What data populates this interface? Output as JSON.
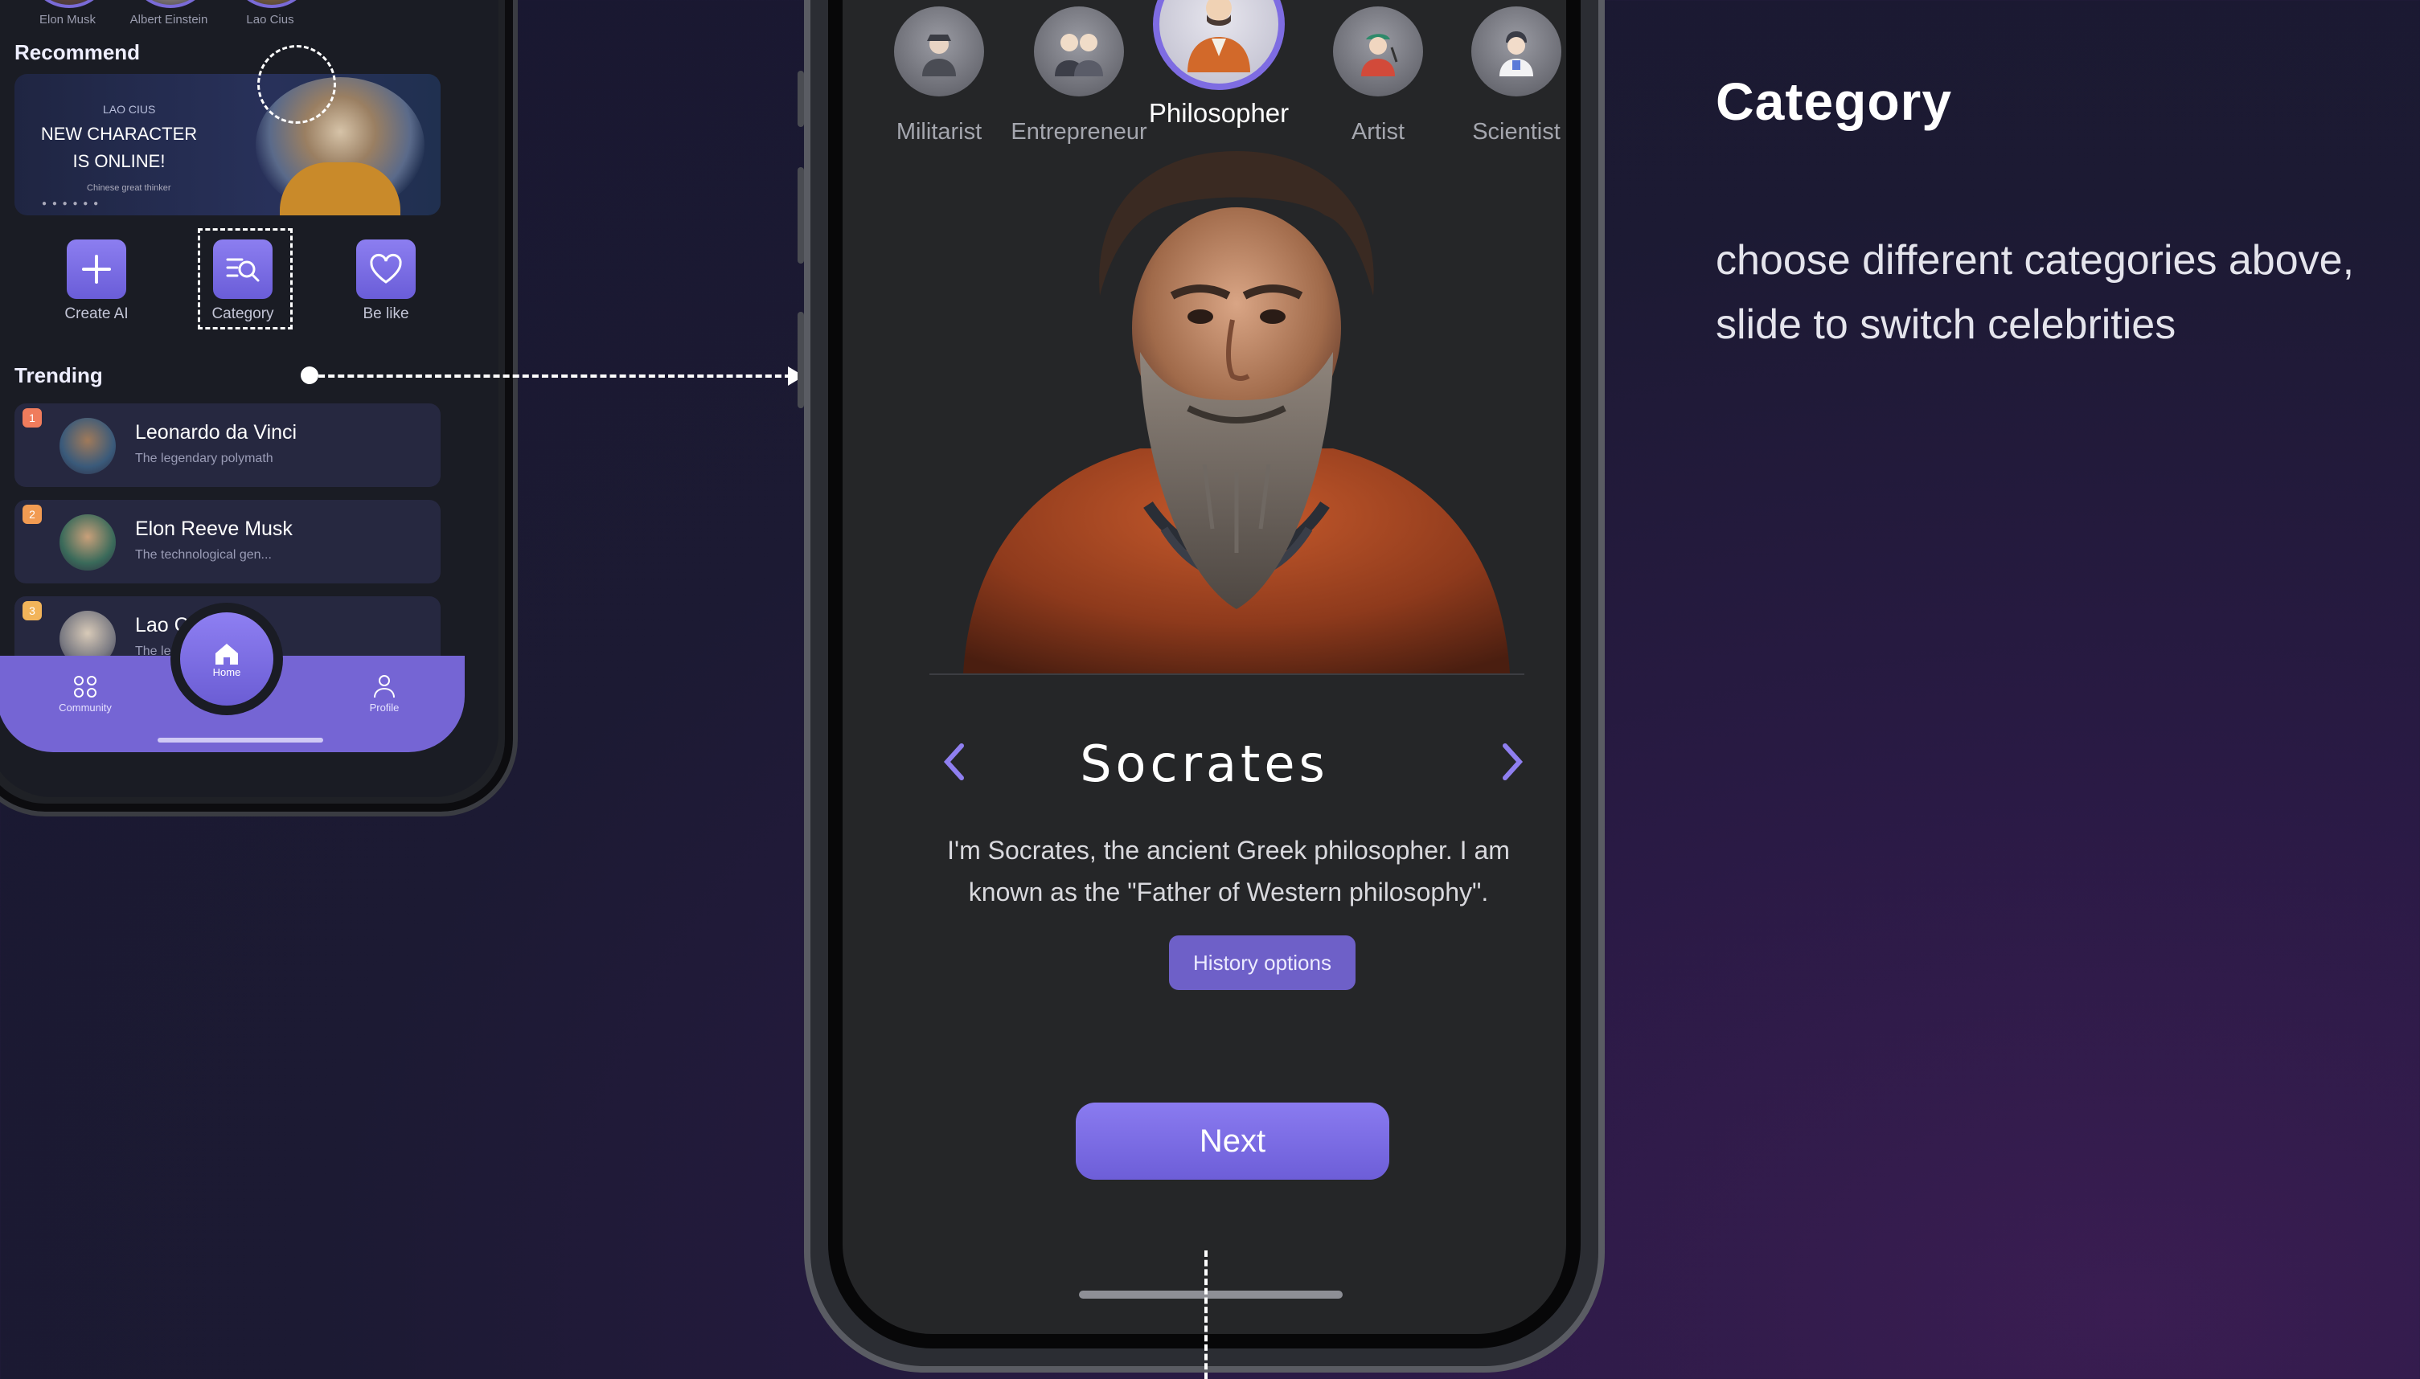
{
  "left_phone": {
    "avatars": [
      {
        "label": "Elon Musk"
      },
      {
        "label": "Albert Einstein"
      },
      {
        "label": "Lao Cius"
      }
    ],
    "recommend_title": "Recommend",
    "banner": {
      "small": "LAO CIUS",
      "headline": "NEW CHARACTER IS ONLINE!",
      "sub": "Chinese great thinker"
    },
    "quick_actions": [
      {
        "label": "Create AI",
        "icon": "plus-icon"
      },
      {
        "label": "Category",
        "icon": "category-search-icon"
      },
      {
        "label": "Be like",
        "icon": "heart-icon"
      }
    ],
    "trending_title": "Trending",
    "trending": [
      {
        "rank": "1",
        "name": "Leonardo da Vinci",
        "desc": "The legendary polymath"
      },
      {
        "rank": "2",
        "name": "Elon Reeve Musk",
        "desc": "The technological gen..."
      },
      {
        "rank": "3",
        "name": "Lao C",
        "desc": "The le"
      }
    ],
    "tabbar": {
      "community": "Community",
      "home": "Home",
      "profile": "Profile"
    }
  },
  "right_phone": {
    "categories": [
      {
        "label": "Militarist",
        "active": false
      },
      {
        "label": "Entrepreneur",
        "active": false
      },
      {
        "label": "Philosopher",
        "active": true
      },
      {
        "label": "Artist",
        "active": false
      },
      {
        "label": "Scientist",
        "active": false
      }
    ],
    "celebrity": {
      "name": "Socrates",
      "bio": "I'm Socrates, the ancient Greek philosopher. I am known as the \"Father of Western philosophy\"."
    },
    "history_button": "History options",
    "next_button": "Next"
  },
  "annotation": {
    "title": "Category",
    "description_line1": "choose different categories above,",
    "description_line2": "slide to switch celebrities"
  },
  "colors": {
    "accent": "#7565d4",
    "button": "#6d5ed8",
    "screen_bg": "#252628",
    "page_bg": "#1c1a33"
  }
}
